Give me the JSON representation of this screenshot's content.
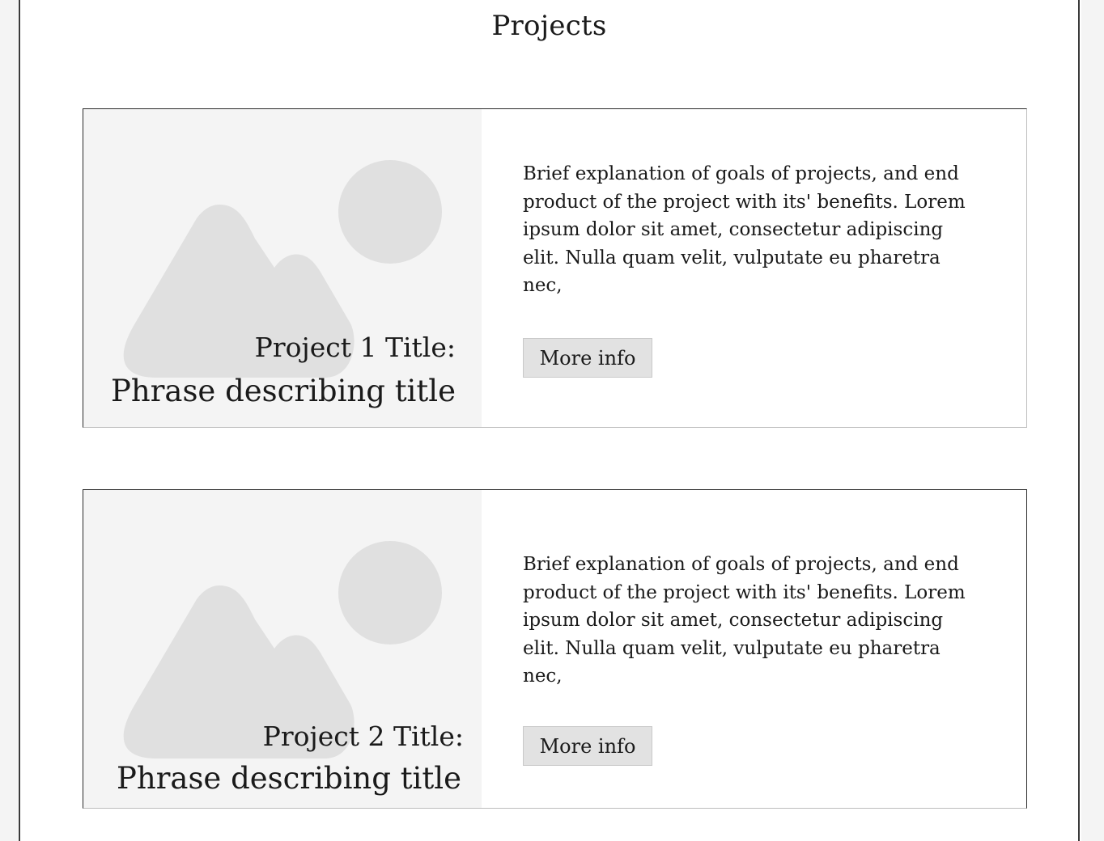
{
  "page": {
    "title": "Projects"
  },
  "projects": [
    {
      "title": "Project 1 Title:",
      "subtitle": "Phrase describing title",
      "description": "Brief explanation of goals of projects, and end product of the project with its' benefits. Lorem ipsum dolor sit amet, consectetur adipiscing elit. Nulla quam velit, vulputate eu pharetra nec,",
      "button_label": "More info",
      "image_icon": "image-placeholder-icon"
    },
    {
      "title": "Project 2 Title:",
      "subtitle": "Phrase describing title",
      "description": "Brief explanation of goals of projects, and end product of the project with its' benefits. Lorem ipsum dolor sit amet, consectetur adipiscing elit. Nulla quam velit, vulputate eu pharetra nec,",
      "button_label": "More info",
      "image_icon": "image-placeholder-icon"
    }
  ],
  "colors": {
    "thumb_background": "#f4f4f4",
    "placeholder_shape": "#e0e0e0",
    "button_background": "#e2e2e2",
    "text": "#1a1a1a",
    "frame": "#3a3a3a"
  }
}
